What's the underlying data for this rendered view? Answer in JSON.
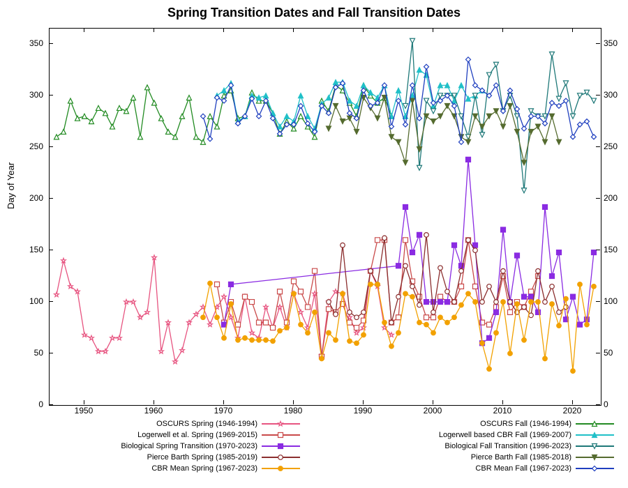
{
  "chart_data": {
    "type": "line",
    "title": "Spring Transition Dates and Fall Transition Dates",
    "xlabel": "",
    "ylabel": "Day of Year",
    "xlim": [
      1945,
      2024
    ],
    "ylim": [
      0,
      365
    ],
    "xticks": [
      1950,
      1960,
      1970,
      1980,
      1990,
      2000,
      2010,
      2020
    ],
    "yticks": [
      0,
      50,
      100,
      150,
      200,
      250,
      300,
      350
    ],
    "legend_position": "bottom",
    "series": [
      {
        "name": "OSCURS Spring (1946-1994)",
        "color": "#e75480",
        "marker": "star",
        "x": [
          1946,
          1947,
          1948,
          1949,
          1950,
          1951,
          1952,
          1953,
          1954,
          1955,
          1956,
          1957,
          1958,
          1959,
          1960,
          1961,
          1962,
          1963,
          1964,
          1965,
          1966,
          1967,
          1968,
          1969,
          1970,
          1971,
          1972,
          1973,
          1974,
          1975,
          1976,
          1977,
          1978,
          1979,
          1980,
          1981,
          1982,
          1983,
          1984,
          1985,
          1986,
          1987,
          1988,
          1989,
          1990,
          1991,
          1992,
          1993,
          1994
        ],
        "values": [
          107,
          140,
          115,
          110,
          68,
          65,
          52,
          52,
          65,
          65,
          100,
          100,
          85,
          90,
          143,
          52,
          80,
          42,
          53,
          80,
          88,
          95,
          78,
          95,
          105,
          85,
          65,
          105,
          70,
          65,
          95,
          75,
          95,
          75,
          108,
          90,
          75,
          108,
          48,
          100,
          110,
          108,
          85,
          70,
          75,
          130,
          115,
          75,
          68
        ]
      },
      {
        "name": "Logerwell et al. Spring (1969-2015)",
        "color": "#c94a4a",
        "marker": "open-square",
        "x": [
          1969,
          1970,
          1971,
          1972,
          1973,
          1974,
          1975,
          1976,
          1977,
          1978,
          1979,
          1980,
          1981,
          1982,
          1983,
          1984,
          1985,
          1986,
          1987,
          1988,
          1989,
          1990,
          1991,
          1992,
          1993,
          1994,
          1995,
          1996,
          1997,
          1998,
          1999,
          2000,
          2001,
          2002,
          2003,
          2004,
          2005,
          2006,
          2007,
          2008,
          2009,
          2010,
          2011,
          2012,
          2013,
          2014,
          2015
        ],
        "values": [
          117,
          80,
          100,
          78,
          105,
          100,
          80,
          80,
          75,
          110,
          80,
          120,
          110,
          95,
          130,
          47,
          93,
          90,
          98,
          80,
          75,
          82,
          130,
          160,
          160,
          80,
          85,
          160,
          120,
          105,
          85,
          85,
          105,
          100,
          100,
          115,
          160,
          115,
          80,
          78,
          95,
          125,
          90,
          100,
          95,
          110,
          125
        ]
      },
      {
        "name": "Biological Spring Transition (1970-2023)",
        "color": "#8a2be2",
        "marker": "filled-square",
        "x": [
          1970,
          1971,
          1995,
          1996,
          1997,
          1998,
          1999,
          2000,
          2001,
          2002,
          2003,
          2004,
          2005,
          2006,
          2007,
          2008,
          2009,
          2010,
          2011,
          2012,
          2013,
          2014,
          2015,
          2016,
          2017,
          2018,
          2019,
          2020,
          2021,
          2022,
          2023
        ],
        "values": [
          78,
          117,
          135,
          192,
          148,
          165,
          100,
          100,
          100,
          100,
          155,
          135,
          238,
          155,
          60,
          65,
          90,
          170,
          100,
          145,
          105,
          105,
          90,
          192,
          125,
          148,
          83,
          105,
          78,
          83,
          148
        ]
      },
      {
        "name": "Pierce Barth Spring (1985-2019)",
        "color": "#8b2e2e",
        "marker": "open-circle",
        "x": [
          1985,
          1986,
          1987,
          1988,
          1989,
          1990,
          1991,
          1992,
          1993,
          1994,
          1995,
          1996,
          1997,
          1998,
          1999,
          2000,
          2001,
          2002,
          2003,
          2004,
          2005,
          2006,
          2007,
          2008,
          2009,
          2010,
          2011,
          2012,
          2013,
          2014,
          2015,
          2016,
          2017,
          2018,
          2019
        ],
        "values": [
          100,
          88,
          155,
          90,
          85,
          90,
          130,
          117,
          162,
          80,
          105,
          135,
          115,
          97,
          165,
          90,
          133,
          110,
          100,
          130,
          160,
          150,
          100,
          115,
          100,
          130,
          100,
          90,
          95,
          87,
          130,
          100,
          115,
          90,
          95
        ]
      },
      {
        "name": "CBR Mean Spring (1967-2023)",
        "color": "#f2a100",
        "marker": "filled-circle",
        "x": [
          1967,
          1968,
          1969,
          1970,
          1971,
          1972,
          1973,
          1974,
          1975,
          1976,
          1977,
          1978,
          1979,
          1980,
          1981,
          1982,
          1983,
          1984,
          1985,
          1986,
          1987,
          1988,
          1989,
          1990,
          1991,
          1992,
          1993,
          1994,
          1995,
          1996,
          1997,
          1998,
          1999,
          2000,
          2001,
          2002,
          2003,
          2004,
          2005,
          2006,
          2007,
          2008,
          2009,
          2010,
          2011,
          2012,
          2013,
          2014,
          2015,
          2016,
          2017,
          2018,
          2019,
          2020,
          2021,
          2022,
          2023
        ],
        "values": [
          85,
          118,
          85,
          65,
          98,
          63,
          65,
          63,
          63,
          63,
          62,
          72,
          75,
          108,
          78,
          70,
          90,
          45,
          70,
          63,
          108,
          62,
          60,
          68,
          117,
          117,
          80,
          57,
          70,
          108,
          105,
          80,
          78,
          70,
          85,
          80,
          85,
          97,
          108,
          100,
          60,
          35,
          70,
          100,
          50,
          98,
          63,
          100,
          100,
          45,
          98,
          77,
          103,
          33,
          117,
          78,
          115
        ]
      },
      {
        "name": "OSCURS Fall (1946-1994)",
        "color": "#228b22",
        "marker": "open-triangle-up",
        "x": [
          1946,
          1947,
          1948,
          1949,
          1950,
          1951,
          1952,
          1953,
          1954,
          1955,
          1956,
          1957,
          1958,
          1959,
          1960,
          1961,
          1962,
          1963,
          1964,
          1965,
          1966,
          1967,
          1968,
          1969,
          1970,
          1971,
          1972,
          1973,
          1974,
          1975,
          1976,
          1977,
          1978,
          1979,
          1980,
          1981,
          1982,
          1983,
          1984,
          1985,
          1986,
          1987,
          1988,
          1989,
          1990,
          1991,
          1992,
          1993,
          1994
        ],
        "values": [
          260,
          265,
          295,
          278,
          280,
          275,
          288,
          283,
          270,
          288,
          285,
          298,
          260,
          308,
          293,
          278,
          265,
          260,
          280,
          298,
          260,
          255,
          280,
          270,
          300,
          305,
          278,
          280,
          303,
          295,
          295,
          283,
          263,
          275,
          268,
          280,
          270,
          260,
          295,
          285,
          310,
          305,
          293,
          280,
          310,
          300,
          293,
          298,
          280
        ]
      },
      {
        "name": "Logerwell based CBR Fall (1969-2007)",
        "color": "#20c0c8",
        "marker": "filled-triangle-up",
        "x": [
          1969,
          1970,
          1971,
          1972,
          1973,
          1974,
          1975,
          1976,
          1977,
          1978,
          1979,
          1980,
          1981,
          1982,
          1983,
          1984,
          1985,
          1986,
          1987,
          1988,
          1989,
          1990,
          1991,
          1992,
          1993,
          1994,
          1995,
          1996,
          1997,
          1998,
          1999,
          2000,
          2001,
          2002,
          2003,
          2004,
          2005,
          2006,
          2007
        ],
        "values": [
          300,
          305,
          312,
          275,
          280,
          300,
          298,
          300,
          283,
          270,
          280,
          275,
          300,
          280,
          268,
          292,
          298,
          313,
          313,
          295,
          290,
          310,
          303,
          298,
          310,
          280,
          305,
          280,
          300,
          325,
          320,
          290,
          310,
          310,
          295,
          310,
          297,
          300,
          305
        ]
      },
      {
        "name": "Biological Fall Transition (1996-2023)",
        "color": "#1e7878",
        "marker": "open-triangle-down",
        "x": [
          1996,
          1997,
          1998,
          1999,
          2000,
          2001,
          2002,
          2003,
          2004,
          2005,
          2006,
          2007,
          2008,
          2009,
          2010,
          2011,
          2012,
          2013,
          2014,
          2015,
          2016,
          2017,
          2018,
          2019,
          2020,
          2021,
          2022,
          2023
        ],
        "values": [
          290,
          353,
          230,
          295,
          285,
          300,
          300,
          300,
          280,
          260,
          300,
          262,
          320,
          330,
          285,
          300,
          280,
          208,
          285,
          280,
          280,
          340,
          297,
          312,
          280,
          300,
          303,
          295
        ]
      },
      {
        "name": "Pierce Barth Fall (1985-2018)",
        "color": "#556b2f",
        "marker": "filled-triangle-down",
        "x": [
          1985,
          1986,
          1987,
          1988,
          1989,
          1990,
          1991,
          1992,
          1993,
          1994,
          1995,
          1996,
          1997,
          1998,
          1999,
          2000,
          2001,
          2002,
          2003,
          2004,
          2005,
          2006,
          2007,
          2008,
          2009,
          2010,
          2011,
          2012,
          2013,
          2014,
          2015,
          2016,
          2017,
          2018
        ],
        "values": [
          268,
          290,
          275,
          278,
          265,
          298,
          288,
          278,
          298,
          260,
          255,
          235,
          295,
          248,
          280,
          275,
          280,
          290,
          280,
          260,
          255,
          280,
          270,
          280,
          285,
          270,
          290,
          265,
          235,
          265,
          270,
          255,
          280,
          255
        ]
      },
      {
        "name": "CBR Mean Fall (1967-2023)",
        "color": "#1f3fbf",
        "marker": "open-diamond",
        "x": [
          1967,
          1968,
          1969,
          1970,
          1971,
          1972,
          1973,
          1974,
          1975,
          1976,
          1977,
          1978,
          1979,
          1980,
          1981,
          1982,
          1983,
          1984,
          1985,
          1986,
          1987,
          1988,
          1989,
          1990,
          1991,
          1992,
          1993,
          1994,
          1995,
          1996,
          1997,
          1998,
          1999,
          2000,
          2001,
          2002,
          2003,
          2004,
          2005,
          2006,
          2007,
          2008,
          2009,
          2010,
          2011,
          2012,
          2013,
          2014,
          2015,
          2016,
          2017,
          2018,
          2019,
          2020,
          2021,
          2022,
          2023
        ],
        "values": [
          280,
          258,
          298,
          295,
          310,
          273,
          280,
          297,
          280,
          295,
          278,
          263,
          272,
          272,
          290,
          273,
          265,
          290,
          283,
          308,
          312,
          283,
          278,
          305,
          290,
          293,
          310,
          270,
          295,
          272,
          310,
          278,
          328,
          293,
          295,
          300,
          290,
          255,
          335,
          310,
          305,
          300,
          310,
          285,
          305,
          287,
          268,
          280,
          280,
          273,
          293,
          290,
          295,
          260,
          272,
          275,
          260
        ]
      }
    ]
  }
}
